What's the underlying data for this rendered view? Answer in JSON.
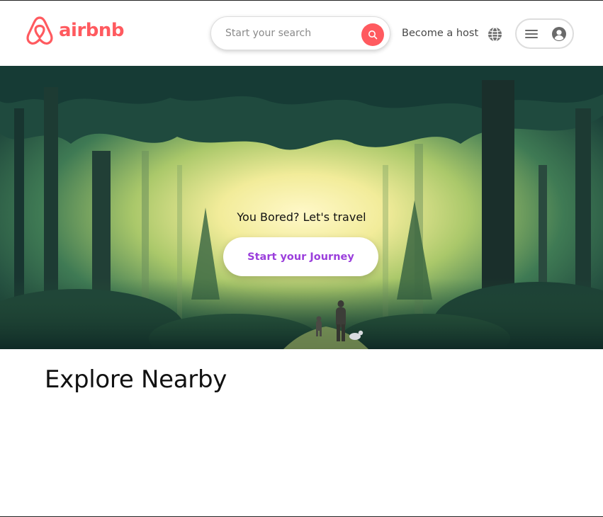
{
  "brand": {
    "name": "airbnb",
    "color": "#ff5a5f"
  },
  "header": {
    "search": {
      "placeholder": "Start your search",
      "value": "",
      "button_icon": "search-icon"
    },
    "become_host_label": "Become a host",
    "globe_icon": "globe-icon",
    "user_menu": {
      "menu_icon": "hamburger-icon",
      "avatar_icon": "user-circle-icon"
    }
  },
  "hero": {
    "tagline": "You Bored? Let's travel",
    "cta_label": "Start your Journey",
    "cta_color": "#9b3fdc",
    "image_subject": "forest-scene"
  },
  "main": {
    "section_title": "Explore Nearby"
  }
}
